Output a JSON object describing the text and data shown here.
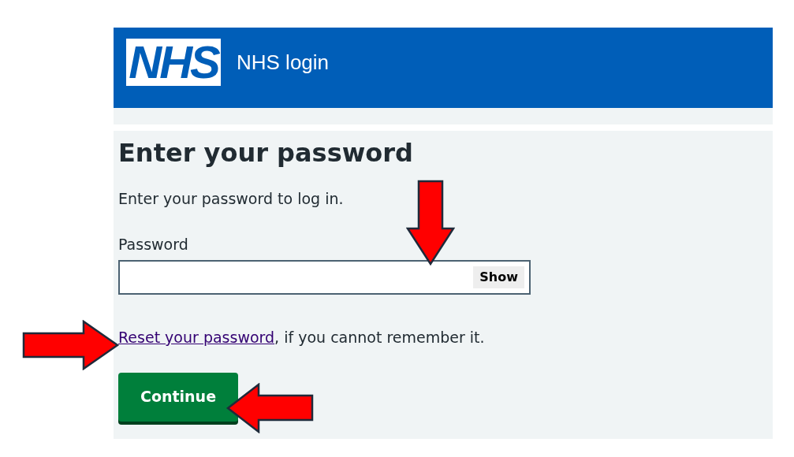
{
  "header": {
    "logo": "NHS",
    "title": "NHS login"
  },
  "main": {
    "heading": "Enter your password",
    "intro": "Enter your password to log in.",
    "password": {
      "label": "Password",
      "toggle": "Show"
    },
    "reset": {
      "link": "Reset your password",
      "text": ", if you cannot remember it."
    },
    "button": "Continue"
  },
  "annotations": [
    {
      "kind": "down"
    },
    {
      "kind": "right"
    },
    {
      "kind": "left"
    }
  ]
}
